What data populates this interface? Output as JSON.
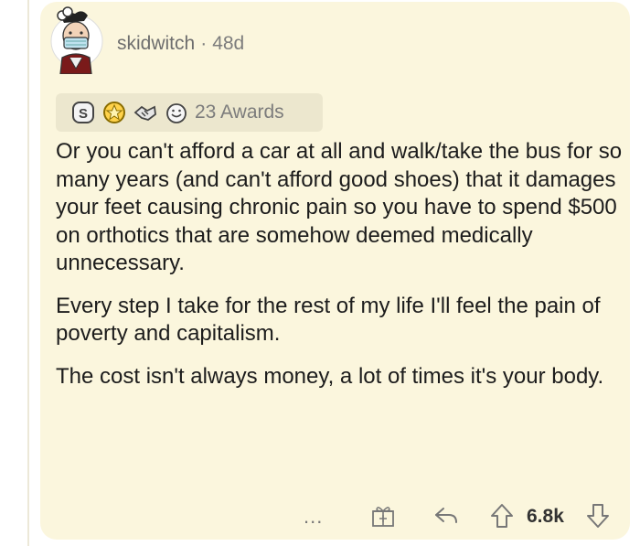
{
  "comment": {
    "username": "skidwitch",
    "separator": "·",
    "age": "48d",
    "awards_label": "23 Awards",
    "award_icons": [
      "silver-award-icon",
      "gold-award-icon",
      "handshake-award-icon",
      "wholesome-award-icon"
    ],
    "paragraphs": [
      "Or you can't afford a car at all and walk/take the bus for so many years (and can't afford good shoes) that it damages your feet causing chronic pain so you have to spend $500 on orthotics that are somehow deemed medically unnecessary.",
      "Every step I take for the rest of my life I'll feel the pain of poverty and capitalism.",
      "The cost isn't always money, a lot of times it's your body."
    ]
  },
  "actions": {
    "more_label": "...",
    "score": "6.8k"
  },
  "colors": {
    "card_background": "#fbf6dd",
    "awards_background": "#ece7ce",
    "body_text": "#1c1c1c",
    "meta_text": "#7c7c7c"
  }
}
